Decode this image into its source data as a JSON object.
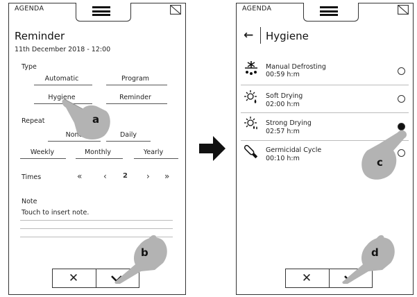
{
  "left": {
    "agenda_label": "AGENDA",
    "title": "Reminder",
    "date": "11th December 2018 - 12:00",
    "type_label": "Type",
    "type_options": [
      "Automatic",
      "Program",
      "Hygiene",
      "Reminder"
    ],
    "repeat_label": "Repeat",
    "repeat_options": [
      "None",
      "Daily",
      "Weekly",
      "Monthly",
      "Yearly"
    ],
    "times_label": "Times",
    "times_value": "2",
    "stepper_symbols": {
      "first": "«",
      "prev": "‹",
      "next": "›",
      "last": "»"
    },
    "note_label": "Note",
    "note_placeholder": "Touch to insert note.",
    "callout_a": "a",
    "callout_b": "b",
    "cancel_symbol": "✕"
  },
  "right": {
    "agenda_label": "AGENDA",
    "back_symbol": "←",
    "title": "Hygiene",
    "cycles": [
      {
        "name": "Manual Defrosting",
        "time": "00:59 h:m",
        "icon": "snowflake-drops-icon",
        "selected": false
      },
      {
        "name": "Soft Drying",
        "time": "02:00 h:m",
        "icon": "sun-drop-icon",
        "selected": false
      },
      {
        "name": "Strong Drying",
        "time": "02:57 h:m",
        "icon": "sun-drops-icon",
        "selected": true
      },
      {
        "name": "Germicidal Cycle",
        "time": "00:10 h:m",
        "icon": "sterilization-lamp-icon",
        "selected": false
      }
    ],
    "callout_c": "c",
    "callout_d": "d",
    "cancel_symbol": "✕"
  },
  "colors": {
    "line": "#333333",
    "hand": "#b3b3b3",
    "text": "#222222",
    "arrow": "#111111"
  }
}
